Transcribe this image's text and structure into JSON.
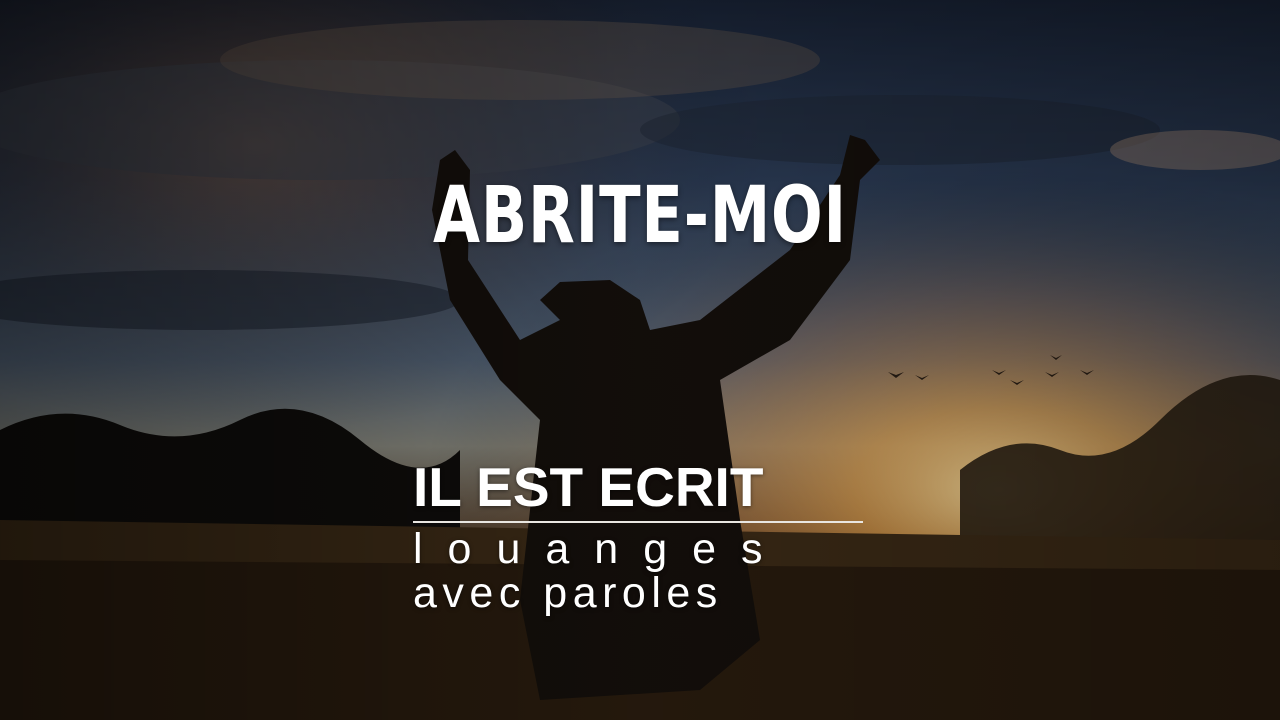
{
  "title": "ABRITE-MOI",
  "brand": {
    "name": "IL EST ECRIT",
    "tagline_line1": "louanges",
    "tagline_line2": "avec paroles"
  },
  "colors": {
    "sky_top": "#1d2d45",
    "sky_mid": "#4a5f78",
    "horizon_glow": "#f6c77a",
    "ground": "#2a1c0f",
    "text": "#ffffff"
  }
}
